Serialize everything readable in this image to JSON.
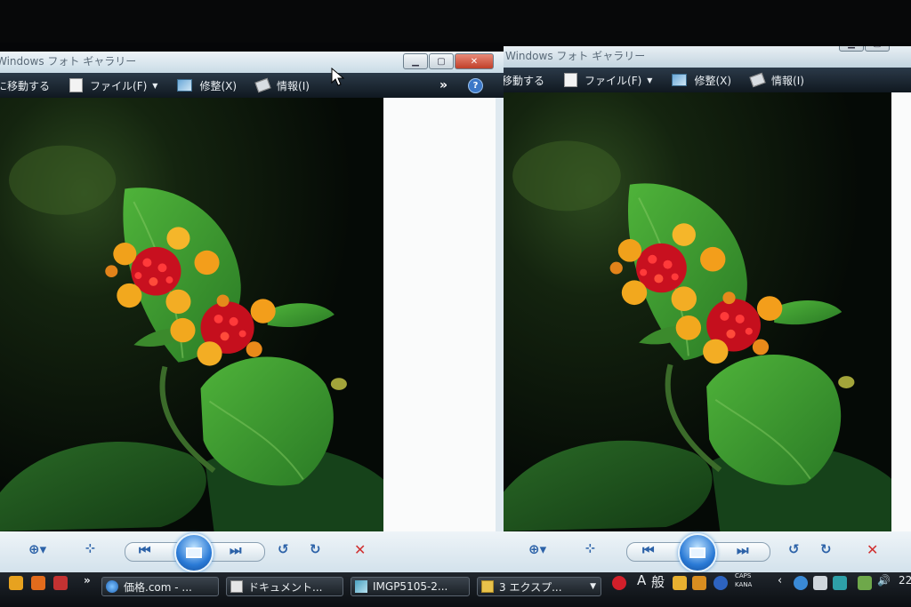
{
  "windows": [
    {
      "title": "Windows フォト ギャラリー",
      "menu": {
        "goto": "に移動する",
        "file": "ファイル(F)",
        "fix": "修整(X)",
        "info": "情報(I)",
        "overflow": "»",
        "help": "?"
      }
    },
    {
      "title": "Windows フォト ギャラリー",
      "menu": {
        "goto": "移動する",
        "file": "ファイル(F)",
        "fix": "修整(X)",
        "info": "情報(I)",
        "help": "?"
      }
    }
  ],
  "taskbar": {
    "items": [
      {
        "label": "価格.com - ..."
      },
      {
        "label": "ドキュメント..."
      },
      {
        "label": "IMGP5105-2..."
      },
      {
        "label": "3 エクスプ..."
      }
    ],
    "ime": {
      "mode": "A",
      "kanji": "般",
      "caps": "CAPS",
      "kana": "KANA"
    },
    "clock_partial": "22"
  },
  "icons": {
    "zoom": "zoom-icon",
    "fit": "actual-size-icon",
    "prev": "previous-icon",
    "slideshow": "slideshow-icon",
    "next": "next-icon",
    "rotate_ccw": "rotate-left-icon",
    "rotate_cw": "rotate-right-icon",
    "delete": "delete-icon"
  },
  "colors": {
    "menubar": "#101820",
    "photo_bg": "#0b120c",
    "leaf": "#3f9a32",
    "flower_red": "#d9152a",
    "flower_orange": "#f2a21c"
  }
}
